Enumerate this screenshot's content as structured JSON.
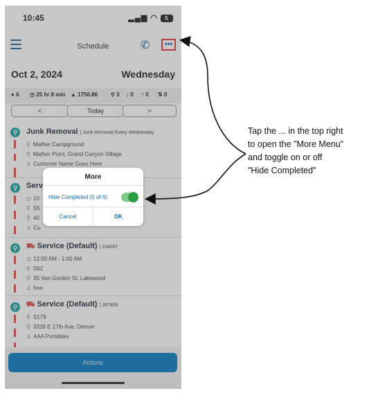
{
  "status_bar": {
    "time": "10:45",
    "battery": "5"
  },
  "nav": {
    "title": "Schedule"
  },
  "date": {
    "date": "Oct 2, 2024",
    "weekday": "Wednesday"
  },
  "stats": [
    "6",
    "25 hr 8 min",
    "1756.86",
    "3",
    "0",
    "0",
    "0"
  ],
  "day_nav": {
    "prev": "<",
    "today": "Today",
    "next": ">"
  },
  "items": [
    {
      "title": "Junk Removal",
      "subtitle": "| Junk Removal Every Wednesday",
      "lines": [
        "Mather Campground",
        "Mather Point, Grand Canyon Village",
        "Customer Name Goes Here"
      ]
    },
    {
      "title": "Servi",
      "subtitle": "",
      "lines": [
        "10",
        "S5",
        "40",
        "Cu"
      ]
    },
    {
      "title": "Service (Default)",
      "subtitle": "| J34287",
      "lines": [
        "12:00 AM - 1:00 AM",
        "S62",
        "35 Van Gordon St. Lakewood",
        "free"
      ]
    },
    {
      "title": "Service (Default)",
      "subtitle": "| J97409",
      "lines": [
        "S179",
        "3339 E 17th Ave. Denver",
        "AAA Portables"
      ]
    }
  ],
  "actions_label": "Actions",
  "dialog": {
    "title": "More",
    "option_label": "Hide Completed (0 of 6)",
    "toggle_on": true,
    "cancel": "Cancel",
    "ok": "OK"
  },
  "annotation": {
    "lines": [
      "Tap the ... in the top right",
      "to open the \"More Menu\"",
      "and toggle on or off",
      "\"Hide Completed\""
    ]
  },
  "colors": {
    "accent": "#1565a8",
    "highlight": "#e53935",
    "toggle": "#2e9e44",
    "marker": "#1aa3a3",
    "action_button": "#0a7cc3"
  }
}
